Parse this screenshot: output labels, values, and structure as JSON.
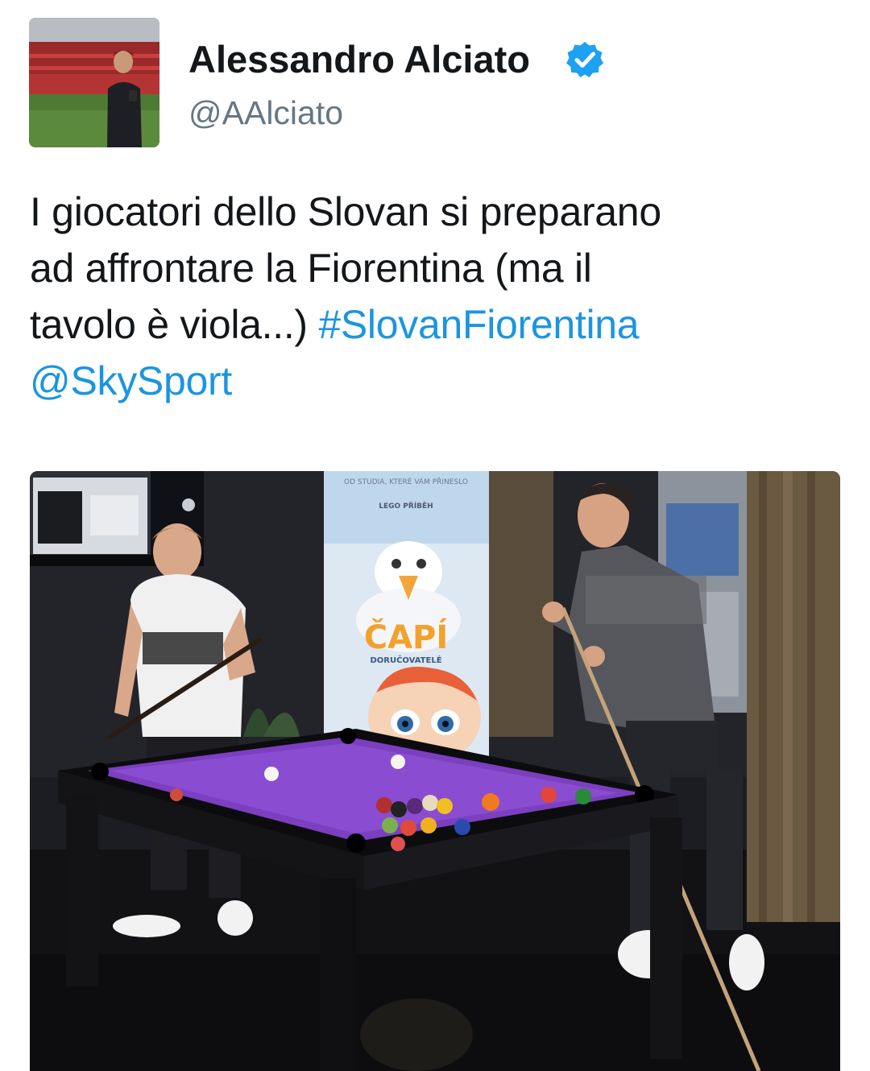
{
  "author": {
    "name": "Alessandro Alciato",
    "handle": "@AAlciato",
    "verified_icon": "verified-badge-icon",
    "verified_color": "#1da1f2"
  },
  "tweet": {
    "text_plain": "I giocatori dello Slovan si preparano ad affrontare la Fiorentina (ma il tavolo è viola...)",
    "line1": "I giocatori dello Slovan si preparano",
    "line2": "ad affrontare la Fiorentina (ma il",
    "line3": "tavolo è viola...)",
    "hashtag": "#SlovanFiorentina",
    "mention": "@SkySport",
    "link_color": "#1b95e0"
  },
  "media": {
    "poster_small": "OD STUDIA, KTERÉ VÁM PŘINESLO",
    "poster_lego": "LEGO PŘÍBĚH",
    "poster_title": "ČAPÍ",
    "poster_subtitle": "DORUČOVATELÉ"
  }
}
